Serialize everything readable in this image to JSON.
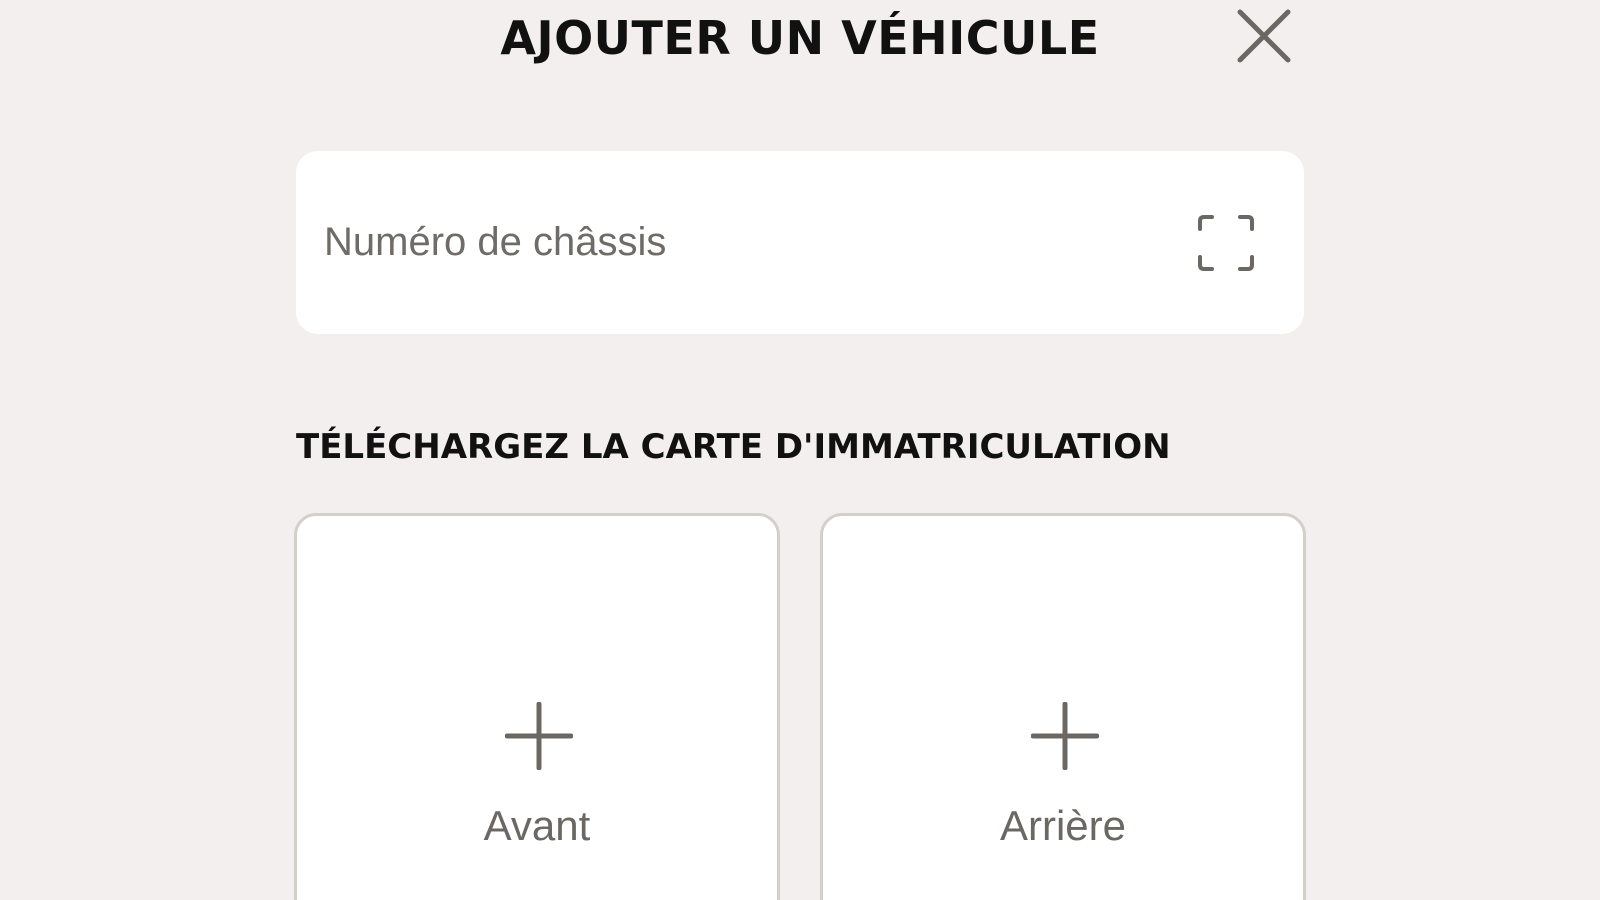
{
  "header": {
    "title": "AJOUTER UN VÉHICULE"
  },
  "vin": {
    "value": "",
    "placeholder": "Numéro de châssis"
  },
  "upload": {
    "heading": "TÉLÉCHARGEZ LA CARTE D'IMMATRICULATION",
    "cards": [
      {
        "label": "Avant"
      },
      {
        "label": "Arrière"
      }
    ]
  },
  "icons": {
    "close": "close-icon",
    "scan": "scan-icon",
    "add": "plus-icon"
  },
  "colors": {
    "background": "#f2efee",
    "surface": "#ffffff",
    "text": "#111111",
    "muted": "#6b6863",
    "border": "#d3d0cc"
  }
}
